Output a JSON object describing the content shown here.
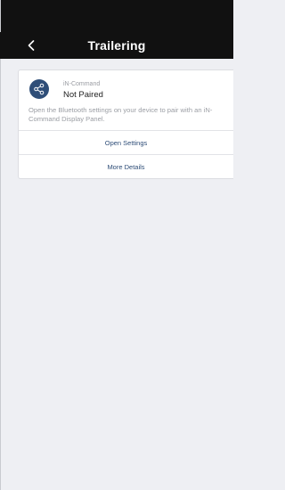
{
  "nav": {
    "title": "Trailering",
    "back_icon": "chevron-left-icon"
  },
  "card": {
    "icon": "share-nodes-icon",
    "brand": "iN-Command",
    "status": "Not Paired",
    "description": "Open the Bluetooth settings on your device to pair with an iN-Command Display Panel.",
    "actions": {
      "open_settings": "Open Settings",
      "more_details": "More Details"
    }
  },
  "colors": {
    "header_bg": "#111111",
    "page_bg": "#eeeff3",
    "accent": "#2f4e78",
    "muted_text": "#9b9ea4"
  }
}
